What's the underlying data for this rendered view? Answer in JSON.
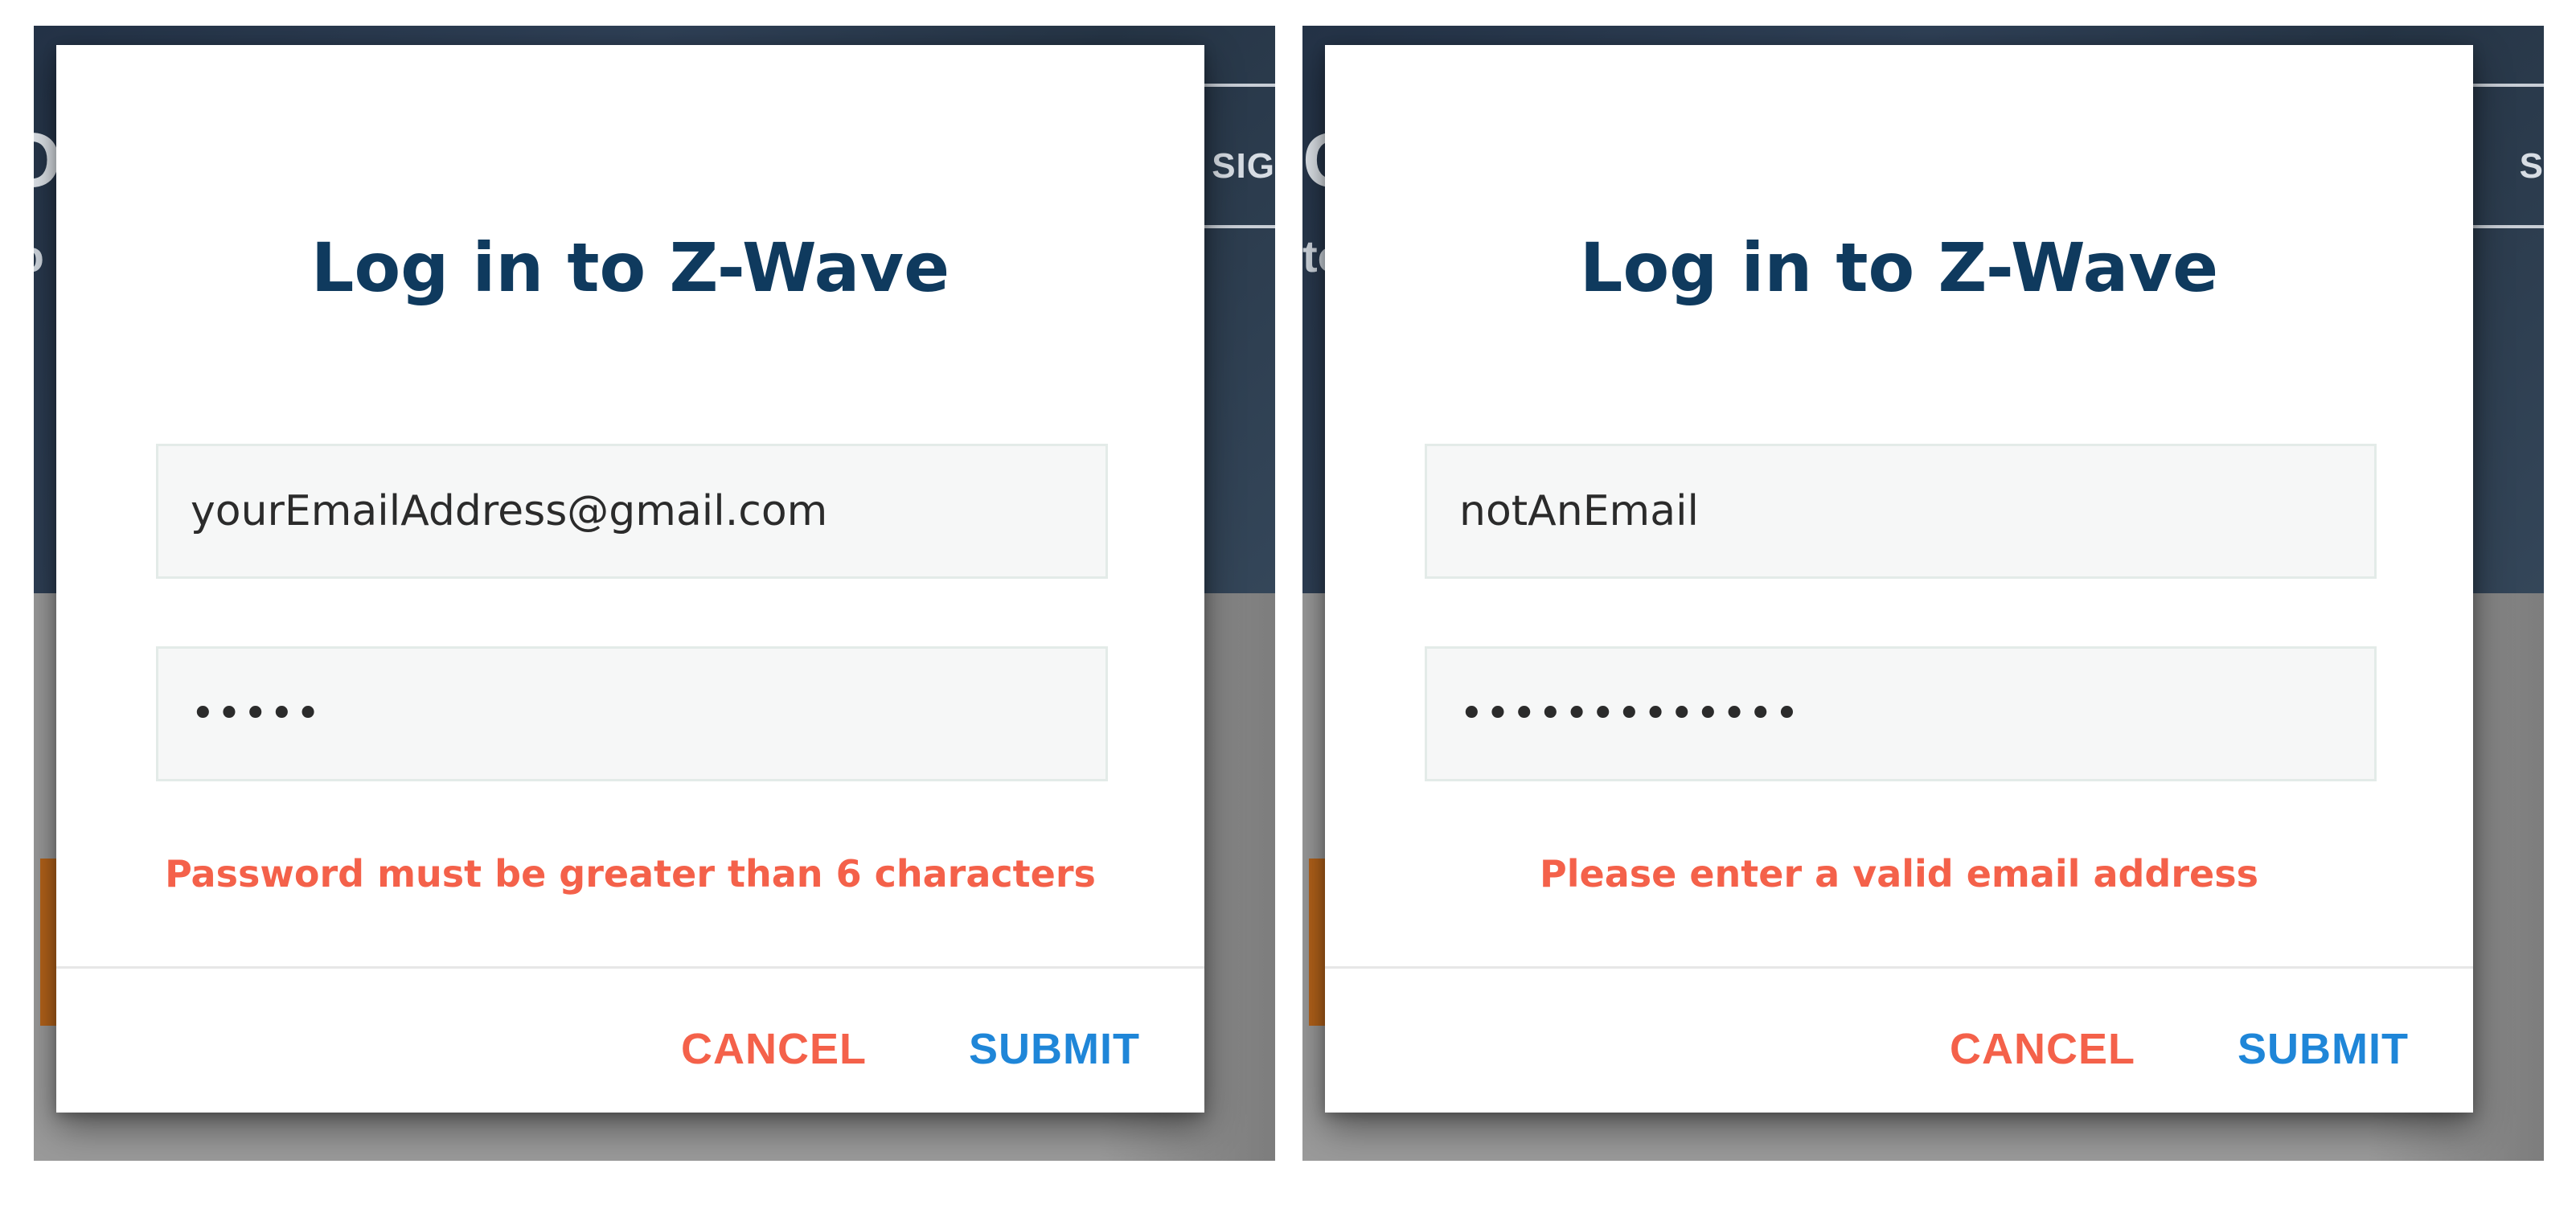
{
  "background": {
    "left_nav_fragment": "SIG",
    "right_nav_fragment": "S",
    "left_big_letter": "O",
    "right_big_letter": "O",
    "left_small_text": "to",
    "right_small_text": "to"
  },
  "dialogs": [
    {
      "title": "Log in to Z-Wave",
      "email_value": "yourEmailAddress@gmail.com",
      "password_value": "12345",
      "error": "Password must be greater than 6 characters",
      "cancel_label": "CANCEL",
      "submit_label": "SUBMIT"
    },
    {
      "title": "Log in to Z-Wave",
      "email_value": "notAnEmail",
      "password_value": "1234567890123",
      "error": "Please enter a valid email address",
      "cancel_label": "CANCEL",
      "submit_label": "SUBMIT"
    }
  ],
  "colors": {
    "title": "#0f3a5e",
    "error": "#f4614a",
    "cancel": "#f4614a",
    "submit": "#1f86d8",
    "backdrop_dark": "#2f4056",
    "backdrop_grey": "#9a9a9a",
    "accent_orange": "#b4631a"
  }
}
